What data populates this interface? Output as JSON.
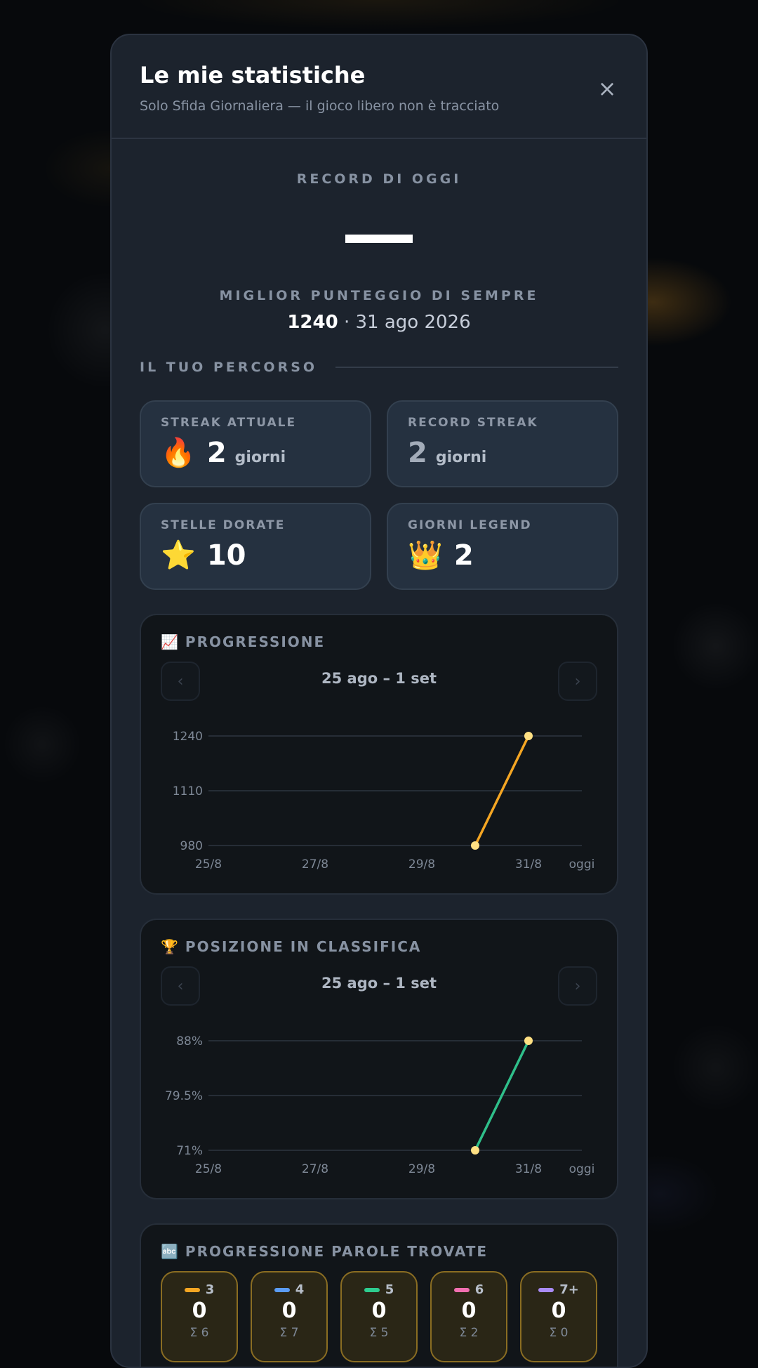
{
  "modal": {
    "title": "Le mie statistiche",
    "subtitle": "Solo Sfida Giornaliera — il gioco libero non è tracciato",
    "close_icon": "×"
  },
  "today": {
    "caption": "RECORD DI OGGI"
  },
  "best": {
    "caption": "MIGLIOR PUNTEGGIO DI SEMPRE",
    "score": "1240",
    "separator": " · ",
    "date": "31 ago 2026"
  },
  "path": {
    "label": "IL TUO PERCORSO"
  },
  "stats": [
    {
      "caption": "STREAK ATTUALE",
      "emoji": "🔥",
      "value": "2",
      "unit": "giorni"
    },
    {
      "caption": "RECORD STREAK",
      "value": "2",
      "unit": "giorni"
    },
    {
      "caption": "STELLE DORATE",
      "emoji": "⭐",
      "value": "10"
    },
    {
      "caption": "GIORNI LEGEND",
      "emoji": "👑",
      "value": "2"
    }
  ],
  "progression": {
    "icon": "📈",
    "title": "PROGRESSIONE",
    "range": "25 ago – 1 set",
    "prev_icon": "‹",
    "next_icon": "›"
  },
  "ranking": {
    "icon": "🏆",
    "title": "POSIZIONE IN CLASSIFICA",
    "range": "25 ago – 1 set",
    "prev_icon": "‹",
    "next_icon": "›"
  },
  "words": {
    "icon": "🔤",
    "title": "PROGRESSIONE PAROLE TROVATE",
    "tiles": [
      {
        "length": "3",
        "count": "0",
        "sum": "Σ 6",
        "color": "#f5a623"
      },
      {
        "length": "4",
        "count": "0",
        "sum": "Σ 7",
        "color": "#5b9cf5"
      },
      {
        "length": "5",
        "count": "0",
        "sum": "Σ 5",
        "color": "#2ecc8f"
      },
      {
        "length": "6",
        "count": "0",
        "sum": "Σ 2",
        "color": "#f06fb0"
      },
      {
        "length": "7+",
        "count": "0",
        "sum": "Σ 0",
        "color": "#a98bf5"
      }
    ]
  },
  "chart_data": [
    {
      "type": "line",
      "title": "PROGRESSIONE",
      "x": [
        "25/8",
        "26/8",
        "27/8",
        "28/8",
        "29/8",
        "30/8",
        "31/8",
        "oggi"
      ],
      "x_tick_labels": [
        "25/8",
        "27/8",
        "29/8",
        "31/8",
        "oggi"
      ],
      "y_tick_labels": [
        "1240",
        "1110",
        "980"
      ],
      "ylim": [
        980,
        1240
      ],
      "series": [
        {
          "points": [
            {
              "x": "30/8",
              "y": 980
            },
            {
              "x": "31/8",
              "y": 1240
            }
          ],
          "color": "#f5a623"
        }
      ],
      "point_color": "#ffe083",
      "grid": true
    },
    {
      "type": "line",
      "title": "POSIZIONE IN CLASSIFICA",
      "x": [
        "25/8",
        "26/8",
        "27/8",
        "28/8",
        "29/8",
        "30/8",
        "31/8",
        "oggi"
      ],
      "x_tick_labels": [
        "25/8",
        "27/8",
        "29/8",
        "31/8",
        "oggi"
      ],
      "y_tick_labels": [
        "88%",
        "79.5%",
        "71%"
      ],
      "ylim": [
        71,
        88
      ],
      "series": [
        {
          "points": [
            {
              "x": "30/8",
              "y": 71
            },
            {
              "x": "31/8",
              "y": 88
            }
          ],
          "color": "#2fbf8a"
        }
      ],
      "point_color": "#ffe083",
      "grid": true
    }
  ]
}
